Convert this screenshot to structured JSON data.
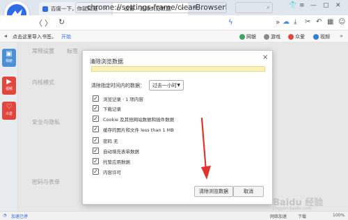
{
  "tabs": [
    {
      "label": "百度一下，你就知道"
    },
    {
      "label": "设置 - 清除浏览数据"
    }
  ],
  "address_bar": {
    "url": "chrome://settings-frame/clearBrowserData"
  },
  "bookmark_bar": {
    "import_hint": "点击这里导入书签。",
    "import_button": "开始",
    "items": [
      {
        "label": "网银",
        "color": "#3aa55d"
      },
      {
        "label": "游戏",
        "color": "#888888"
      },
      {
        "label": "众爱",
        "color": "#e2453c"
      },
      {
        "label": "视频",
        "color": "#2f7ee0"
      }
    ]
  },
  "sidebar": {
    "apps": [
      {
        "label": "相册",
        "color": "#4a8fd8",
        "icon": "gallery-icon"
      },
      {
        "label": "视频",
        "color": "#e2453c",
        "icon": "video-icon"
      },
      {
        "label": "众爱",
        "color": "#e2453c",
        "icon": "charity-icon"
      }
    ]
  },
  "settings_page": {
    "tabs": [
      "常规设置",
      "标签",
      "",
      "",
      ""
    ],
    "sections": [
      "内核模式",
      "安全与隐私",
      "密码与表单"
    ]
  },
  "dialog": {
    "title": "清除浏览数据",
    "range_label": "清除指定时间内的数据：",
    "range_value": "过去一小时",
    "options": [
      {
        "label": "浏览记录 · 1 项内容",
        "checked": true
      },
      {
        "label": "下载记录",
        "checked": true
      },
      {
        "label": "Cookie 及其他网站数据和插件数据",
        "checked": true
      },
      {
        "label": "缓存的图片和文件  less than 1 MB",
        "checked": true
      },
      {
        "label": "密码  无",
        "checked": true
      },
      {
        "label": "自动填充表单数据",
        "checked": true
      },
      {
        "label": "托管应用数据",
        "checked": true
      },
      {
        "label": "内容许可",
        "checked": true
      }
    ],
    "clear_button": "清除浏览数据",
    "cancel_button": "取消"
  },
  "status_bar": {
    "left": "加速已停",
    "right_items": [
      "网络加速",
      "下载",
      "100%"
    ]
  },
  "watermark": {
    "text": "Baidu 经验",
    "url": "jingyan.baidu.com"
  }
}
